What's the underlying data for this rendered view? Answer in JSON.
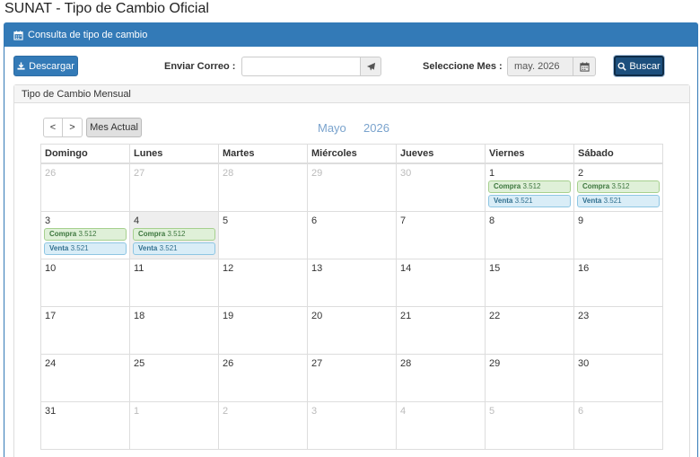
{
  "page": {
    "title": "SUNAT - Tipo de Cambio Oficial"
  },
  "panel": {
    "heading": "Consulta de tipo de cambio"
  },
  "toolbar": {
    "download_label": "Descargar",
    "email_label": "Enviar Correo :",
    "email_value": "",
    "month_label": "Seleccione Mes :",
    "month_value": "may. 2026",
    "search_label": "Buscar"
  },
  "calendar": {
    "heading": "Tipo de Cambio Mensual",
    "prev": "<",
    "next": ">",
    "today_label": "Mes Actual",
    "month_name": "Mayo",
    "year": "2026",
    "weekdays": [
      "Domingo",
      "Lunes",
      "Martes",
      "Miércoles",
      "Jueves",
      "Viernes",
      "Sábado"
    ],
    "buy_label": "Compra",
    "sell_label": "Venta",
    "weeks": [
      [
        {
          "d": "26",
          "muted": true
        },
        {
          "d": "27",
          "muted": true
        },
        {
          "d": "28",
          "muted": true
        },
        {
          "d": "29",
          "muted": true
        },
        {
          "d": "30",
          "muted": true
        },
        {
          "d": "1",
          "buy": "3.512",
          "sell": "3.521"
        },
        {
          "d": "2",
          "buy": "3.512",
          "sell": "3.521"
        }
      ],
      [
        {
          "d": "3",
          "buy": "3.512",
          "sell": "3.521"
        },
        {
          "d": "4",
          "buy": "3.512",
          "sell": "3.521",
          "today": true
        },
        {
          "d": "5"
        },
        {
          "d": "6"
        },
        {
          "d": "7"
        },
        {
          "d": "8"
        },
        {
          "d": "9"
        }
      ],
      [
        {
          "d": "10"
        },
        {
          "d": "11"
        },
        {
          "d": "12"
        },
        {
          "d": "13"
        },
        {
          "d": "14"
        },
        {
          "d": "15"
        },
        {
          "d": "16"
        }
      ],
      [
        {
          "d": "17"
        },
        {
          "d": "18"
        },
        {
          "d": "19"
        },
        {
          "d": "20"
        },
        {
          "d": "21"
        },
        {
          "d": "22"
        },
        {
          "d": "23"
        }
      ],
      [
        {
          "d": "24"
        },
        {
          "d": "25"
        },
        {
          "d": "26"
        },
        {
          "d": "27"
        },
        {
          "d": "28"
        },
        {
          "d": "29"
        },
        {
          "d": "30"
        }
      ],
      [
        {
          "d": "31"
        },
        {
          "d": "1",
          "muted": true
        },
        {
          "d": "2",
          "muted": true
        },
        {
          "d": "3",
          "muted": true
        },
        {
          "d": "4",
          "muted": true
        },
        {
          "d": "5",
          "muted": true
        },
        {
          "d": "6",
          "muted": true
        }
      ]
    ]
  },
  "colors": {
    "primary": "#337ab7",
    "search": "#1c4f7d",
    "title": "#7aa3cd",
    "buy_bg": "#dff0d8",
    "sell_bg": "#d9edf7"
  }
}
